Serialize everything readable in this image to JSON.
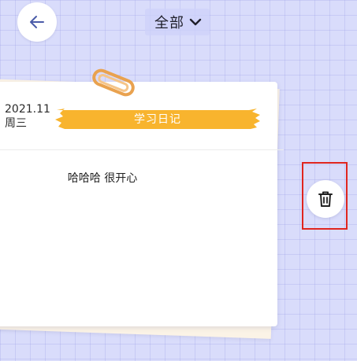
{
  "header": {
    "back_icon": "arrow-left-icon",
    "filter_label": "全部",
    "filter_icon": "chevron-down-icon"
  },
  "diary": {
    "date": "2021.11",
    "weekday": "周三",
    "category": "学习日记",
    "content": "哈哈哈 很开心"
  },
  "actions": {
    "delete_icon": "trash-icon"
  },
  "colors": {
    "background": "#d9dcfb",
    "tape": "#f8b42e",
    "accent": "#4a5ba8",
    "highlight": "#e0261f"
  }
}
